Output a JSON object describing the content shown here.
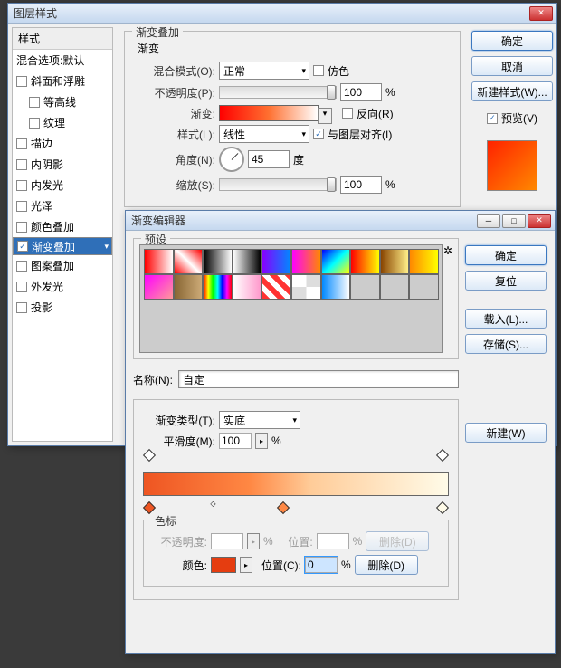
{
  "win1": {
    "title": "图层样式",
    "styles_header": "样式",
    "blend_options": "混合选项:默认",
    "items": [
      {
        "label": "斜面和浮雕",
        "checked": false
      },
      {
        "label": "等高线",
        "checked": false,
        "indent": true
      },
      {
        "label": "纹理",
        "checked": false,
        "indent": true
      },
      {
        "label": "描边",
        "checked": false
      },
      {
        "label": "内阴影",
        "checked": false
      },
      {
        "label": "内发光",
        "checked": false
      },
      {
        "label": "光泽",
        "checked": false
      },
      {
        "label": "颜色叠加",
        "checked": false
      },
      {
        "label": "渐变叠加",
        "checked": true,
        "selected": true
      },
      {
        "label": "图案叠加",
        "checked": false
      },
      {
        "label": "外发光",
        "checked": false
      },
      {
        "label": "投影",
        "checked": false
      }
    ],
    "panel_title": "渐变叠加",
    "subpanel_title": "渐变",
    "blend_mode_label": "混合模式(O):",
    "blend_mode_value": "正常",
    "dither_label": "仿色",
    "opacity_label": "不透明度(P):",
    "opacity_value": "100",
    "pct": "%",
    "gradient_label": "渐变:",
    "reverse_label": "反向(R)",
    "style_label": "样式(L):",
    "style_value": "线性",
    "align_label": "与图层对齐(I)",
    "angle_label": "角度(N):",
    "angle_value": "45",
    "angle_unit": "度",
    "scale_label": "缩放(S):",
    "scale_value": "100",
    "ok": "确定",
    "cancel": "取消",
    "new_style": "新建样式(W)...",
    "preview_label": "预览(V)"
  },
  "win2": {
    "title": "渐变编辑器",
    "presets_label": "预设",
    "ok": "确定",
    "reset": "复位",
    "load": "载入(L)...",
    "save": "存储(S)...",
    "name_label": "名称(N):",
    "name_value": "自定",
    "new_btn": "新建(W)",
    "grad_type_label": "渐变类型(T):",
    "grad_type_value": "实底",
    "smooth_label": "平滑度(M):",
    "smooth_value": "100",
    "pct": "%",
    "stops_label": "色标",
    "opacity_label": "不透明度:",
    "pos_label": "位置:",
    "pos2_label": "位置(C):",
    "pos_value": "0",
    "color_label": "颜色:",
    "delete": "删除(D)"
  },
  "swatches": [
    "linear-gradient(90deg,#f00,#fff)",
    "linear-gradient(45deg,#f00,#fff 50%,#f00)",
    "linear-gradient(90deg,#000,#fff)",
    "linear-gradient(90deg,#fff,#000)",
    "linear-gradient(90deg,#80f,#08f)",
    "linear-gradient(90deg,#f0f,#f80)",
    "linear-gradient(135deg,#00f,#0ff,#ff0)",
    "linear-gradient(90deg,#f00,#ff0)",
    "linear-gradient(90deg,#840,#fe8)",
    "linear-gradient(90deg,#f80,#ff0)",
    "linear-gradient(135deg,#f0f,#f99)",
    "linear-gradient(90deg,#863,#ca7)",
    "linear-gradient(90deg,#f00,#ff0,#0f0,#0ff,#00f,#f0f,#f00)",
    "linear-gradient(90deg,#fff,#f9c)",
    "repeating-linear-gradient(45deg,#f33 0 6px,#fff 6px 12px)",
    "repeating-conic-gradient(#ddd 0 25%,#fff 0 50%)",
    "linear-gradient(90deg,#08f,#fff)",
    "#ccc",
    "#ccc",
    "#ccc"
  ]
}
